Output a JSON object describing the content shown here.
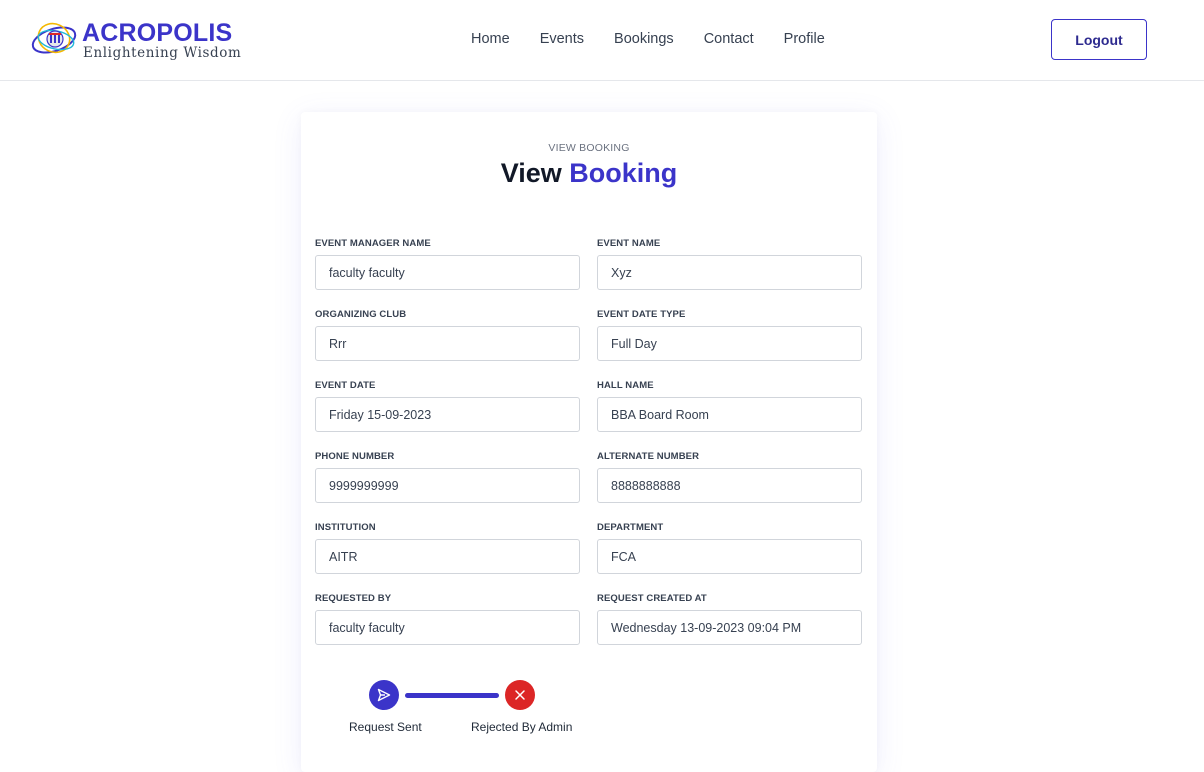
{
  "brand": {
    "name": "ACROPOLIS",
    "tagline": "Enlightening Wisdom"
  },
  "nav": {
    "items": [
      "Home",
      "Events",
      "Bookings",
      "Contact",
      "Profile"
    ]
  },
  "header": {
    "logout_label": "Logout"
  },
  "page": {
    "eyebrow": "VIEW BOOKING",
    "title_part1": "View",
    "title_part2": "Booking"
  },
  "fields": [
    {
      "label": "EVENT MANAGER NAME",
      "value": "faculty faculty"
    },
    {
      "label": "EVENT NAME",
      "value": "Xyz"
    },
    {
      "label": "ORGANIZING CLUB",
      "value": "Rrr"
    },
    {
      "label": "EVENT DATE TYPE",
      "value": "Full Day"
    },
    {
      "label": "EVENT DATE",
      "value": "Friday 15-09-2023"
    },
    {
      "label": "HALL NAME",
      "value": "BBA Board Room"
    },
    {
      "label": "PHONE NUMBER",
      "value": "9999999999"
    },
    {
      "label": "ALTERNATE NUMBER",
      "value": "8888888888"
    },
    {
      "label": "INSTITUTION",
      "value": "AITR"
    },
    {
      "label": "DEPARTMENT",
      "value": "FCA"
    },
    {
      "label": "REQUESTED BY",
      "value": "faculty faculty"
    },
    {
      "label": "REQUEST CREATED AT",
      "value": "Wednesday 13-09-2023 09:04 PM"
    }
  ],
  "status": {
    "steps": [
      {
        "label": "Request Sent",
        "icon": "send-icon",
        "color": "#3b34c9"
      },
      {
        "label": "Rejected By Admin",
        "icon": "close-icon",
        "color": "#dc2626"
      }
    ]
  },
  "colors": {
    "accent": "#3b34c9",
    "danger": "#dc2626"
  }
}
